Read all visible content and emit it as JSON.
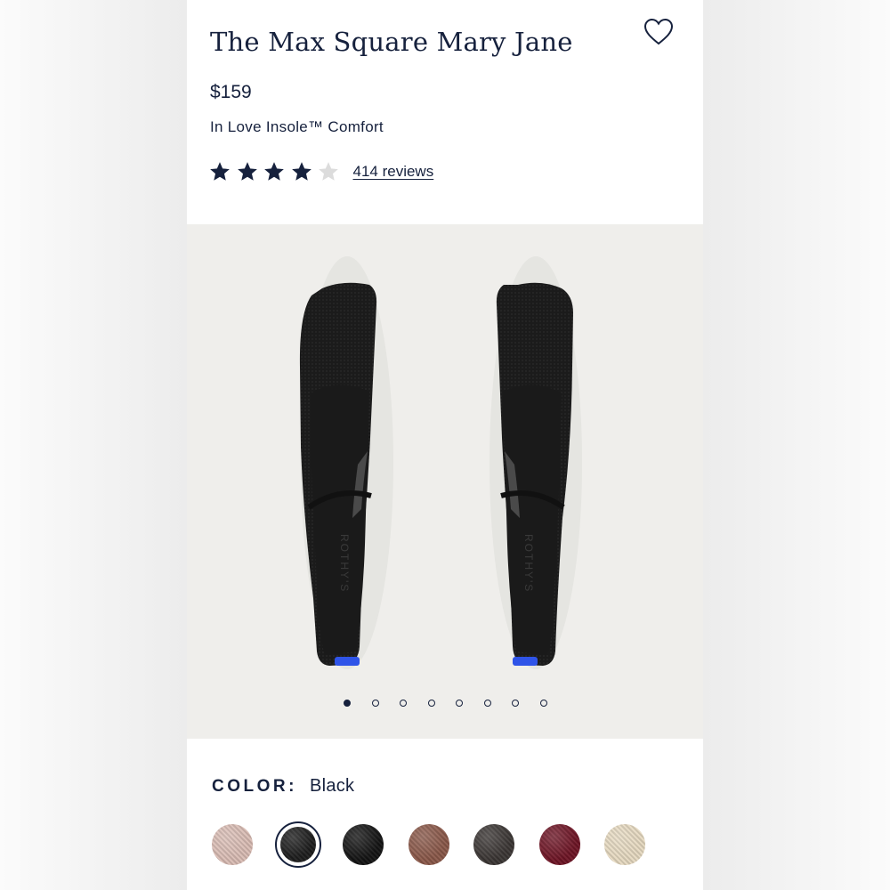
{
  "product": {
    "title": "The Max Square Mary Jane",
    "price": "$159",
    "subtitle": "In Love Insole™ Comfort",
    "rating": 4,
    "rating_max": 5,
    "reviews_label": "414 reviews"
  },
  "gallery": {
    "insole_brand": "ROTHY'S",
    "slide_count": 8,
    "active_slide": 1
  },
  "color": {
    "label": "COLOR:",
    "selected": "Black",
    "swatches": [
      {
        "name": "swatch-blush",
        "color": "#d9bcb4"
      },
      {
        "name": "swatch-black",
        "color": "#1d1d1d",
        "selected": true
      },
      {
        "name": "swatch-black-knit",
        "color": "#131313"
      },
      {
        "name": "swatch-brown",
        "color": "#8a5849"
      },
      {
        "name": "swatch-checker",
        "color": "#3b3634"
      },
      {
        "name": "swatch-burgundy",
        "color": "#6e1525"
      },
      {
        "name": "swatch-cream",
        "color": "#e6d9c0"
      }
    ]
  },
  "colors": {
    "navy": "#16213d",
    "star_empty": "#dcdcdc",
    "gallery_bg": "#efeeeb",
    "heel_tab": "#2f54e8"
  },
  "icons": {
    "favorite": "heart-outline-icon",
    "star": "star-icon"
  }
}
